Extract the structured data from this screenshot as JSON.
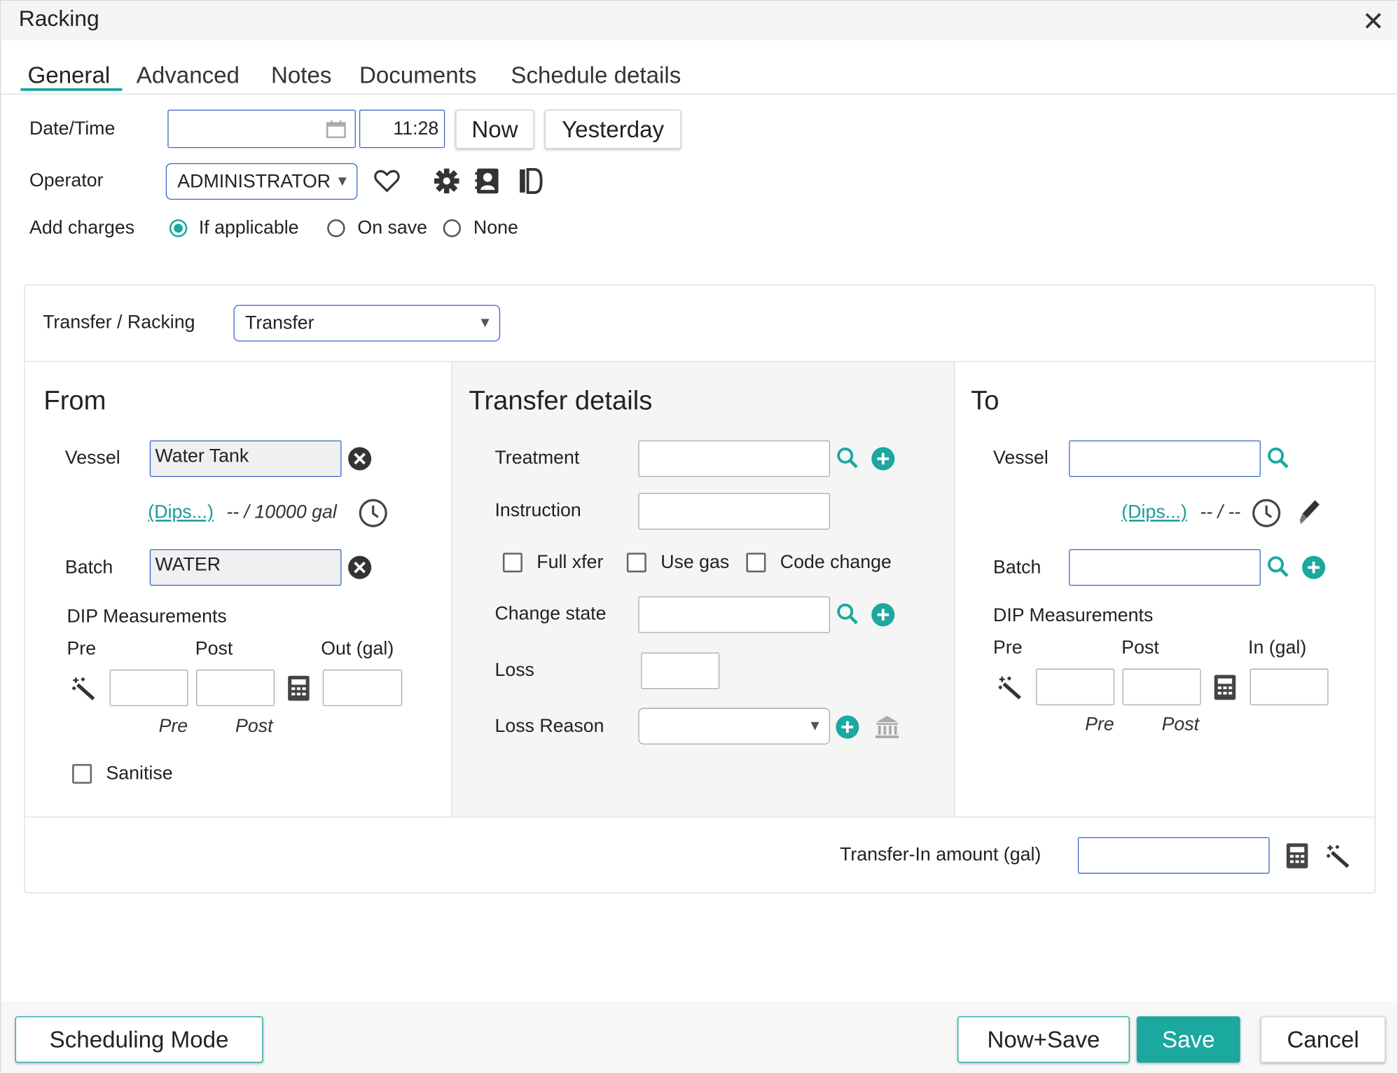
{
  "dialog": {
    "title": "Racking"
  },
  "tabs": [
    "General",
    "Advanced",
    "Notes",
    "Documents",
    "Schedule details"
  ],
  "general": {
    "datetime_label": "Date/Time",
    "date_value": "",
    "time_value": "11:28",
    "now_label": "Now",
    "yesterday_label": "Yesterday",
    "operator_label": "Operator",
    "operator_value": "ADMINISTRATOR",
    "add_charges_label": "Add charges",
    "charges_options": [
      "If applicable",
      "On save",
      "None"
    ],
    "charges_selected": "If applicable"
  },
  "transfer": {
    "type_label": "Transfer / Racking",
    "type_value": "Transfer"
  },
  "from": {
    "heading": "From",
    "vessel_label": "Vessel",
    "vessel_value": "Water Tank",
    "dips_link": "(Dips...)",
    "capacity_text": "-- / 10000 gal",
    "batch_label": "Batch",
    "batch_value": "WATER",
    "dip_heading": "DIP Measurements",
    "col_pre": "Pre",
    "col_post": "Post",
    "col_out": "Out (gal)",
    "sub_pre": "Pre",
    "sub_post": "Post",
    "sanitise_label": "Sanitise"
  },
  "details": {
    "heading": "Transfer details",
    "treatment_label": "Treatment",
    "instruction_label": "Instruction",
    "full_xfer_label": "Full xfer",
    "use_gas_label": "Use gas",
    "code_change_label": "Code change",
    "change_state_label": "Change state",
    "loss_label": "Loss",
    "loss_reason_label": "Loss Reason"
  },
  "to": {
    "heading": "To",
    "vessel_label": "Vessel",
    "dips_link": "(Dips...)",
    "capacity_text": "-- / --",
    "batch_label": "Batch",
    "dip_heading": "DIP Measurements",
    "col_pre": "Pre",
    "col_post": "Post",
    "col_in": "In (gal)",
    "sub_pre": "Pre",
    "sub_post": "Post"
  },
  "footer_row": {
    "transfer_in_label": "Transfer-In amount (gal)"
  },
  "actions": {
    "scheduling_mode": "Scheduling Mode",
    "now_save": "Now+Save",
    "save": "Save",
    "cancel": "Cancel"
  },
  "colors": {
    "accent": "#1aa89f",
    "input_border": "#3465c8"
  }
}
